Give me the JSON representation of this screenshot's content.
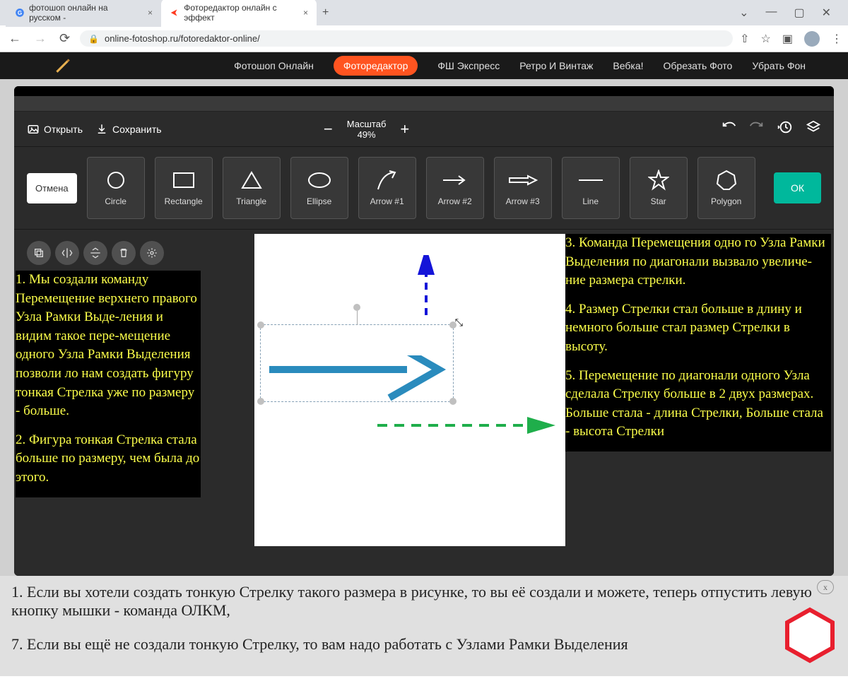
{
  "browser": {
    "tabs": [
      {
        "title": "фотошоп онлайн на русском - "
      },
      {
        "title": "Фоторедактор онлайн с эффект"
      }
    ],
    "url": "online-fotoshop.ru/fotoredaktor-online/"
  },
  "nav": {
    "items": [
      "Фотошоп Онлайн",
      "Фоторедактор",
      "ФШ Экспресс",
      "Ретро И Винтаж",
      "Вебка!",
      "Обрезать Фото",
      "Убрать Фон"
    ],
    "activeIndex": 1
  },
  "toolbar": {
    "open": "Открыть",
    "save": "Сохранить",
    "zoomLabel": "Масштаб",
    "zoomValue": "49%"
  },
  "shapes": {
    "cancel": "Отмена",
    "ok": "ОК",
    "tools": [
      "Circle",
      "Rectangle",
      "Triangle",
      "Ellipse",
      "Arrow #1",
      "Arrow #2",
      "Arrow #3",
      "Line",
      "Star",
      "Polygon"
    ]
  },
  "annotations": {
    "left1": "1. Мы создали команду Перемещение верхнего правого Узла Рамки Выде-ления и видим такое пере-мещение одного Узла Рамки Выделения позволи ло нам создать фигуру тонкая Стрелка уже по размеру - больше.",
    "left2": "2. Фигура тонкая Стрелка стала больше по размеру, чем была до этого.",
    "right1": "3. Команда Перемещения одно го Узла Рамки Выделения по диагонали вызвало увеличе-ние размера стрелки.",
    "right2": "4. Размер Стрелки стал больше в длину и немного больше стал размер Стрелки в высоту.",
    "right3": "5. Перемещение по диагонали одного Узла сделала Стрелку больше в 2 двух размерах. Больше стала - длина Стрелки, Больше стала - высота Стрелки"
  },
  "bottom": {
    "p1": "1. Если вы хотели создать тонкую Стрелку такого размера в рисунке, то вы её создали и можете, теперь отпустить левую кнопку мышки - команда ОЛКМ,",
    "p2": "7. Если вы ещё не создали тонкую Стрелку, то вам надо работать с Узлами Рамки Выделения",
    "close": "x"
  }
}
